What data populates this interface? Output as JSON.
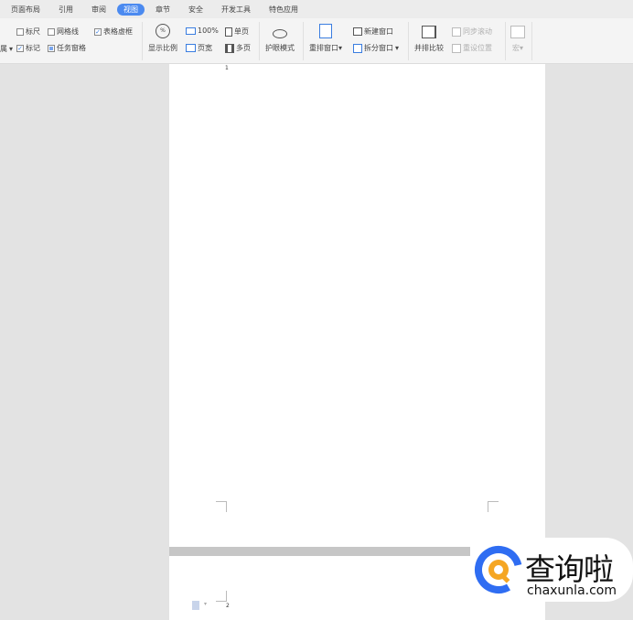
{
  "tabs": [
    "页面布局",
    "引用",
    "审阅",
    "视图",
    "章节",
    "安全",
    "开发工具",
    "特色应用"
  ],
  "ribbon": {
    "partial_left": "属",
    "ruler": "标尺",
    "gridlines": "网格线",
    "table_gridlines": "表格虚框",
    "marks": "标记",
    "task_pane": "任务窗格",
    "zoom": "显示比例",
    "hundred": "100%",
    "single_page": "单页",
    "page_width": "页宽",
    "multi_page": "多页",
    "eye_protect": "护眼模式",
    "rearrange": "重排窗口",
    "new_window": "新建窗口",
    "split_window": "拆分窗口",
    "side_by_side": "并排比较",
    "sync_scroll": "同步滚动",
    "reset_position": "重设位置",
    "macro": "宏"
  },
  "document": {
    "page1_number": "1",
    "page2_number": "2"
  },
  "watermark": {
    "name": "查询啦",
    "url": "chaxunla.com"
  }
}
